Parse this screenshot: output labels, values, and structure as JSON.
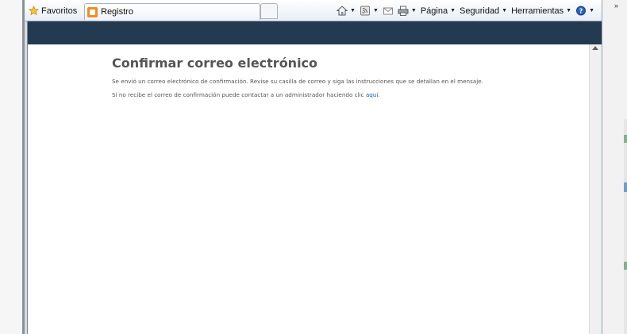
{
  "toolbar": {
    "favorites_label": "Favoritos",
    "tab_title": "Registro",
    "menu_page": "Página",
    "menu_security": "Seguridad",
    "menu_tools": "Herramientas",
    "overflow": "»"
  },
  "page": {
    "title": "Confirmar correo electrónico",
    "message1": "Se envió un correo electrónico de confirmación. Revise su casilla de correo y siga las instrucciones que se detallan en el mensaje.",
    "message2_prefix": "Si no recibe el correo de confirmación puede contactar a un administrador haciendo clic ",
    "message2_link": "aquí",
    "message2_suffix": "."
  },
  "colors": {
    "header_bar": "#233a51",
    "link": "#1a62b0",
    "title": "#555555"
  },
  "icons": [
    "star-icon",
    "tab-favicon",
    "home-icon",
    "feeds-icon",
    "read-mail-icon",
    "print-icon",
    "help-icon"
  ]
}
